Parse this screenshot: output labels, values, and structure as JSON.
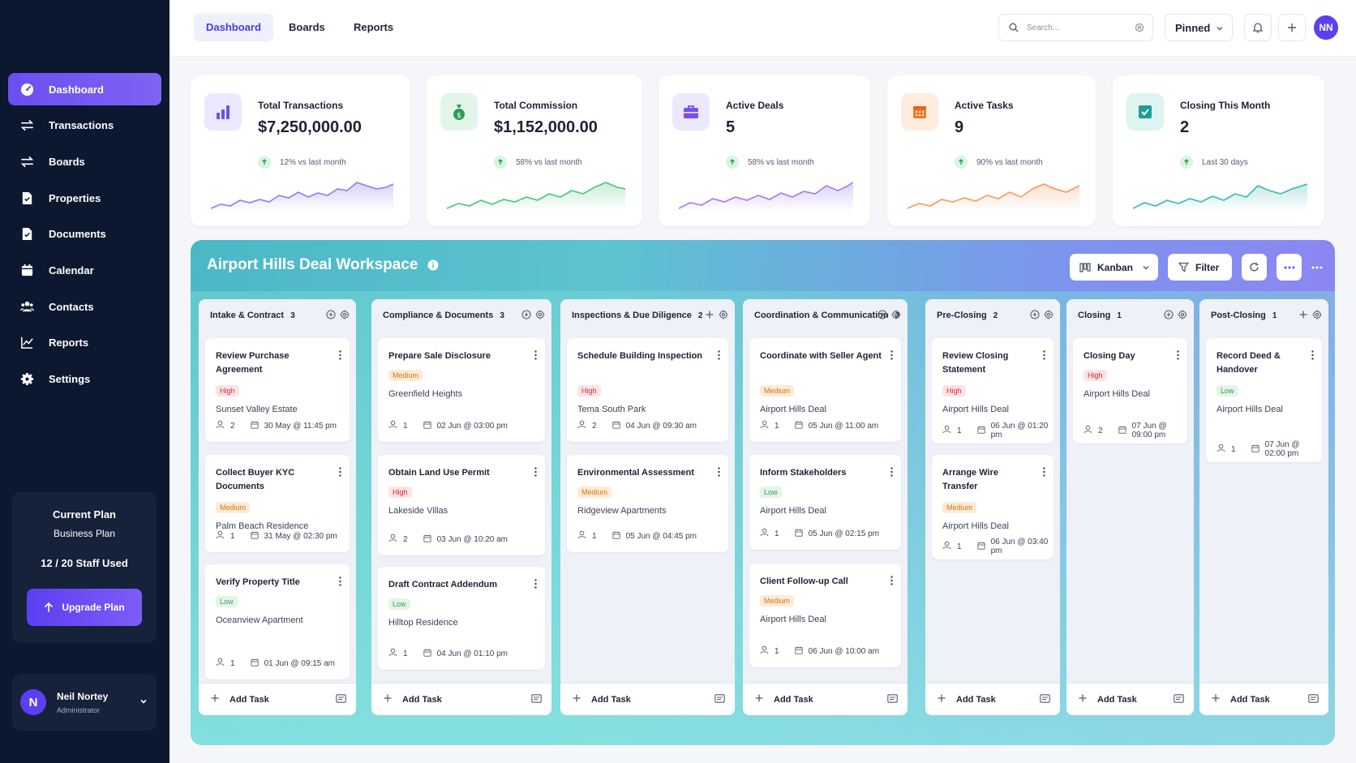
{
  "sidebar": {
    "nav": [
      {
        "label": "Dashboard",
        "icon": "dashboard-icon",
        "active": true
      },
      {
        "label": "Transactions",
        "icon": "transactions-icon"
      },
      {
        "label": "Boards",
        "icon": "boards-icon"
      },
      {
        "label": "Properties",
        "icon": "properties-icon"
      },
      {
        "label": "Documents",
        "icon": "documents-icon"
      },
      {
        "label": "Calendar",
        "icon": "calendar-icon"
      },
      {
        "label": "Contacts",
        "icon": "contacts-icon"
      },
      {
        "label": "Reports",
        "icon": "reports-icon"
      },
      {
        "label": "Settings",
        "icon": "settings-icon"
      }
    ],
    "plan": {
      "heading": "Current Plan",
      "name": "Business Plan",
      "usage": "12 / 20 Staff Used",
      "upgrade_label": "Upgrade Plan"
    },
    "user": {
      "initial": "N",
      "name": "Neil Nortey",
      "role": "Administrator"
    }
  },
  "topbar": {
    "tabs": [
      {
        "label": "Dashboard",
        "active": true
      },
      {
        "label": "Boards"
      },
      {
        "label": "Reports"
      }
    ],
    "search_placeholder": "Search...",
    "pinned_label": "Pinned",
    "avatar_initials": "NN"
  },
  "stats": [
    {
      "title": "Total Transactions",
      "value": "$7,250,000.00",
      "trend": "12% vs last month",
      "icon": "bar-chart-icon",
      "color": "#6b4ff0",
      "bg": "#ece8fd"
    },
    {
      "title": "Total Commission",
      "value": "$1,152,000.00",
      "trend": "58% vs last month",
      "icon": "money-bag-icon",
      "color": "#2e9c59",
      "bg": "#e3f5e8"
    },
    {
      "title": "Active Deals",
      "value": "5",
      "trend": "58% vs last month",
      "icon": "briefcase-icon",
      "color": "#7a4ff0",
      "bg": "#ece8fd"
    },
    {
      "title": "Active Tasks",
      "value": "9",
      "trend": "90% vs last month",
      "icon": "calendar-icon",
      "color": "#f07a2a",
      "bg": "#fdece0"
    },
    {
      "title": "Closing This Month",
      "value": "2",
      "trend": "Last 30 days",
      "icon": "check-box-icon",
      "color": "#1f9e94",
      "bg": "#dff3f1"
    }
  ],
  "workspace": {
    "title": "Airport Hills Deal Workspace",
    "view_label": "Kanban",
    "filter_label": "Filter",
    "add_task_label": "Add Task",
    "columns": [
      {
        "name": "Intake & Contract",
        "count": "3",
        "cards": [
          {
            "title": "Review Purchase Agreement",
            "priority": "High",
            "location": "Sunset Valley Estate",
            "people": "2",
            "date": "30 May @ 11:45 pm"
          },
          {
            "title": "Collect Buyer KYC Documents",
            "priority": "Medium",
            "location": "Palm Beach Residence",
            "people": "1",
            "date": "31 May @ 02:30 pm"
          },
          {
            "title": "Verify Property Title",
            "priority": "Low",
            "location": "Oceanview Apartment",
            "people": "1",
            "date": "01 Jun @ 09:15 am"
          }
        ]
      },
      {
        "name": "Compliance & Documents",
        "count": "3",
        "cards": [
          {
            "title": "Prepare Sale Disclosure",
            "priority": "Medium",
            "location": "Greenfield Heights",
            "people": "1",
            "date": "02 Jun @ 03:00 pm"
          },
          {
            "title": "Obtain Land Use Permit",
            "priority": "High",
            "location": "Lakeside Villas",
            "people": "2",
            "date": "03 Jun @ 10:20 am"
          },
          {
            "title": "Draft Contract Addendum",
            "priority": "Low",
            "location": "Hilltop Residence",
            "people": "1",
            "date": "04 Jun @ 01:10 pm"
          }
        ]
      },
      {
        "name": "Inspections & Due Diligence",
        "count": "2",
        "cards": [
          {
            "title": "Schedule Building Inspection",
            "priority": "High",
            "location": "Tema South Park",
            "people": "2",
            "date": "04 Jun @ 09:30 am"
          },
          {
            "title": "Environmental Assessment",
            "priority": "Medium",
            "location": "Ridgeview Apartments",
            "people": "1",
            "date": "05 Jun @ 04:45 pm"
          }
        ]
      },
      {
        "name": "Coordination & Communication",
        "count": "3",
        "cards": [
          {
            "title": "Coordinate with Seller Agent",
            "priority": "Medium",
            "location": "Airport Hills Deal",
            "people": "1",
            "date": "05 Jun @ 11:00 am"
          },
          {
            "title": "Inform Stakeholders",
            "priority": "Low",
            "location": "Airport Hills Deal",
            "people": "1",
            "date": "05 Jun @ 02:15 pm"
          },
          {
            "title": "Client Follow-up Call",
            "priority": "Medium",
            "location": "Airport Hills Deal",
            "people": "1",
            "date": "06 Jun @ 10:00 am"
          }
        ]
      },
      {
        "name": "Pre-Closing",
        "count": "2",
        "cards": [
          {
            "title": "Review Closing Statement",
            "priority": "High",
            "location": "Airport Hills Deal",
            "people": "1",
            "date": "06 Jun @ 01:20 pm"
          },
          {
            "title": "Arrange Wire Transfer",
            "priority": "Medium",
            "location": "Airport Hills Deal",
            "people": "1",
            "date": "06 Jun @ 03:40 pm"
          }
        ]
      },
      {
        "name": "Closing",
        "count": "1",
        "cards": [
          {
            "title": "Closing Day",
            "priority": "High",
            "location": "Airport Hills Deal",
            "people": "2",
            "date": "07 Jun @ 09:00 pm"
          }
        ]
      },
      {
        "name": "Post-Closing",
        "count": "1",
        "cards": [
          {
            "title": "Record Deed & Handover",
            "priority": "Low",
            "location": "Airport Hills Deal",
            "people": "1",
            "date": "07 Jun @ 02:00 pm"
          }
        ]
      }
    ]
  }
}
